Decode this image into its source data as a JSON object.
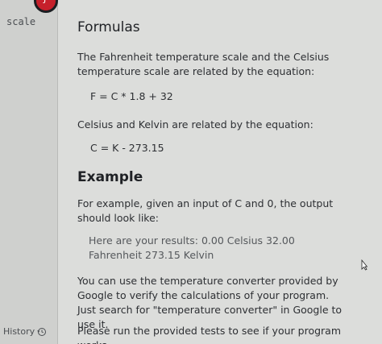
{
  "sidebar": {
    "title": "scale",
    "badge_text": "J",
    "history_label": "History"
  },
  "main": {
    "formulas_heading": "Formulas",
    "intro_paragraph": "The Fahrenheit temperature scale and the Celsius temperature scale are related by the equation:",
    "equation_fahrenheit": "F = C * 1.8 + 32",
    "kelvin_paragraph": "Celsius and Kelvin are related by the equation:",
    "equation_kelvin": "C = K - 273.15",
    "example_heading": "Example",
    "example_paragraph": "For example, given an input of C and 0, the output should look like:",
    "example_output": "Here are your results: 0.00 Celsius 32.00 Fahrenheit 273.15 Kelvin",
    "google_paragraph": "You can use the temperature converter provided by Google to verify the calculations of your program. Just search for \"temperature converter\" in Google to use it.",
    "tests_paragraph": "Please run the provided tests to see if your program works"
  }
}
